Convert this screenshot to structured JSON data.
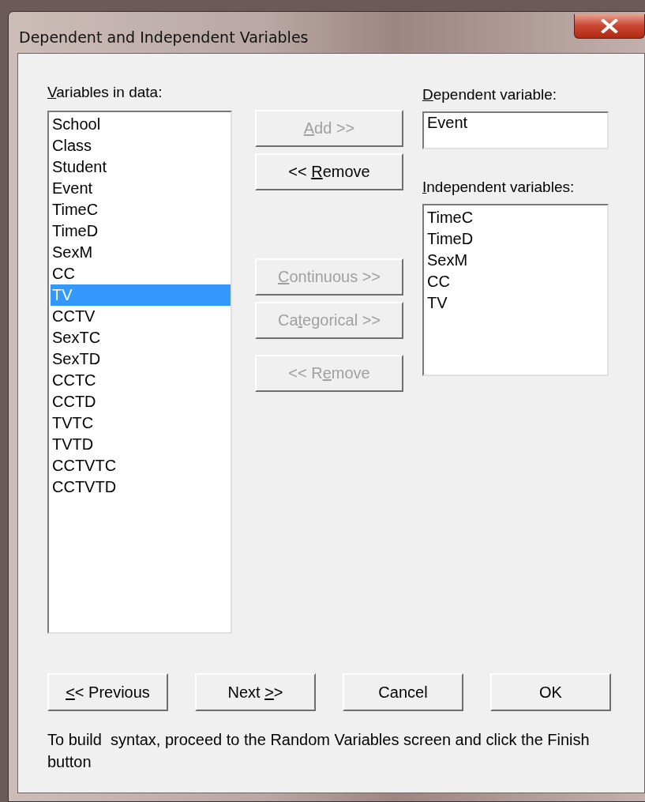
{
  "window": {
    "title": "Dependent and Independent Variables"
  },
  "variables_label": {
    "key": "V",
    "post": "ariables in data:"
  },
  "variables": [
    {
      "name": "School",
      "selected": false
    },
    {
      "name": "Class",
      "selected": false
    },
    {
      "name": "Student",
      "selected": false
    },
    {
      "name": "Event",
      "selected": false
    },
    {
      "name": "TimeC",
      "selected": false
    },
    {
      "name": "TimeD",
      "selected": false
    },
    {
      "name": "SexM",
      "selected": false
    },
    {
      "name": "CC",
      "selected": false
    },
    {
      "name": "TV",
      "selected": true
    },
    {
      "name": "CCTV",
      "selected": false
    },
    {
      "name": "SexTC",
      "selected": false
    },
    {
      "name": "SexTD",
      "selected": false
    },
    {
      "name": "CCTC",
      "selected": false
    },
    {
      "name": "CCTD",
      "selected": false
    },
    {
      "name": "TVTC",
      "selected": false
    },
    {
      "name": "TVTD",
      "selected": false
    },
    {
      "name": "CCTVTC",
      "selected": false
    },
    {
      "name": "CCTVTD",
      "selected": false
    }
  ],
  "dependent_buttons": [
    {
      "key": "A",
      "post": "dd  >>",
      "disabled": true
    },
    {
      "pre": "<< ",
      "key": "R",
      "post": "emove",
      "disabled": false
    }
  ],
  "independent_buttons": [
    {
      "key": "C",
      "post": "ontinuous >>",
      "disabled": true
    },
    {
      "pre": "Ca",
      "key": "t",
      "post": "egorical >>",
      "disabled": true
    }
  ],
  "independent_remove": {
    "pre": "<< R",
    "key": "e",
    "post": "move",
    "disabled": true
  },
  "dependent_label": {
    "key": "D",
    "post": "ependent variable:"
  },
  "dependent_value": "Event",
  "independent_label": {
    "key": "I",
    "post": "ndependent variables:"
  },
  "independent_variables": [
    "TimeC",
    "TimeD",
    "SexM",
    "CC",
    "TV"
  ],
  "nav_buttons": [
    {
      "key": "<",
      "post": "< Previous"
    },
    {
      "pre": "Next ",
      "key": ">",
      "post": ">"
    },
    {
      "pre": "Cancel"
    },
    {
      "pre": "OK"
    }
  ],
  "note": "To build  syntax, proceed to the Random Variables screen and click the Finish button"
}
